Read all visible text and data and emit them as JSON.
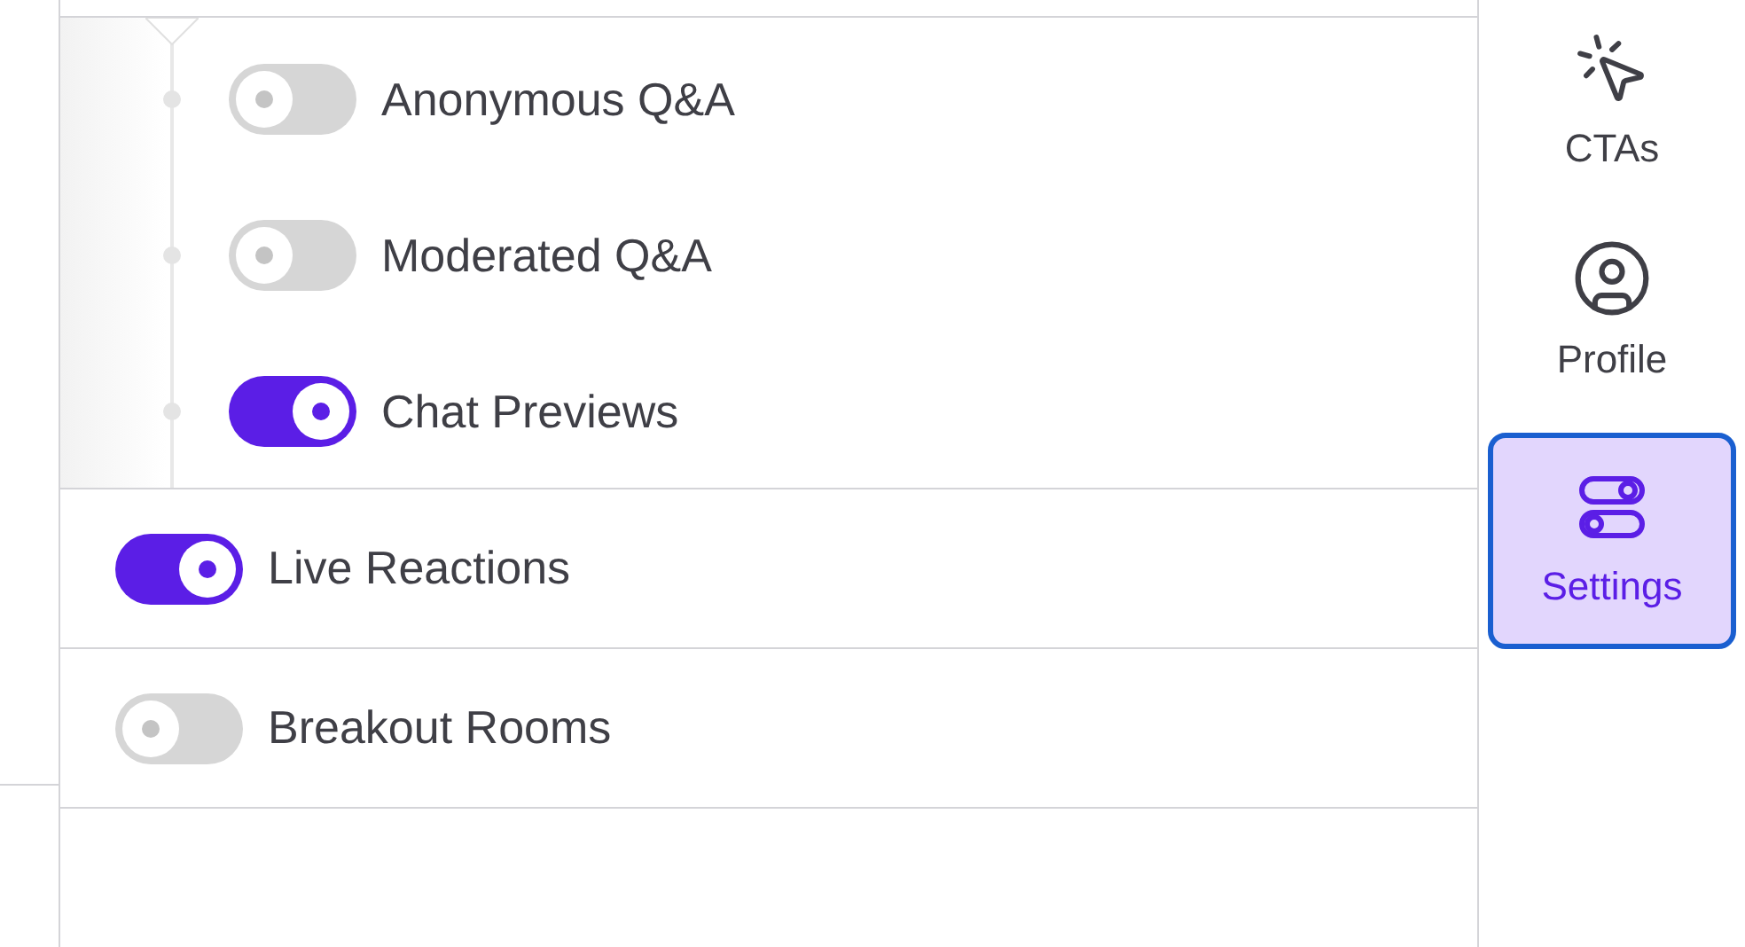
{
  "sub_toggles": [
    {
      "label": "Anonymous Q&A",
      "on": false
    },
    {
      "label": "Moderated Q&A",
      "on": false
    },
    {
      "label": "Chat Previews",
      "on": true
    }
  ],
  "toggles": [
    {
      "label": "Live Reactions",
      "on": true
    },
    {
      "label": "Breakout Rooms",
      "on": false
    }
  ],
  "sidebar": {
    "items": [
      {
        "kind": "cta",
        "label": "CTAs",
        "selected": false
      },
      {
        "kind": "profile",
        "label": "Profile",
        "selected": false
      },
      {
        "kind": "settings",
        "label": "Settings",
        "selected": true
      }
    ]
  }
}
